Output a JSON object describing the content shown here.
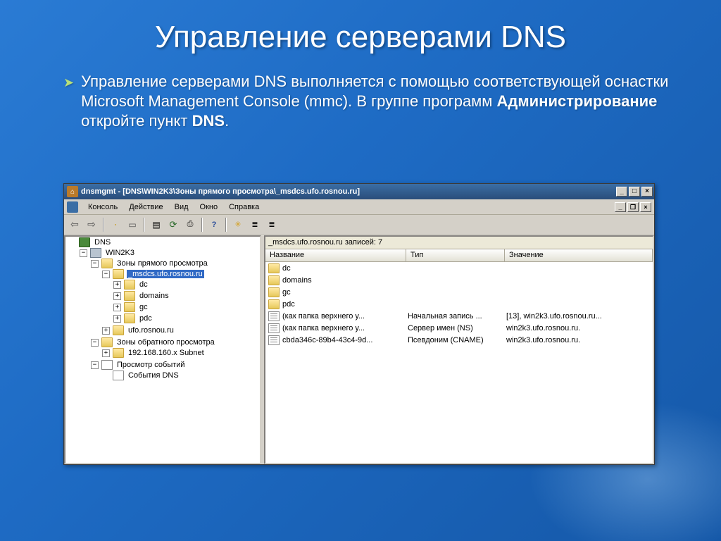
{
  "slide": {
    "title": "Управление серверами DNS",
    "bullet_pre": "Управление серверами DNS выполняется с помощью соответствующей оснастки Microsoft Management Console (mmc). В группе программ ",
    "bullet_bold1": "Администрирование",
    "bullet_mid": " откройте пункт ",
    "bullet_bold2": "DNS",
    "bullet_post": "."
  },
  "window": {
    "title": "dnsmgmt - [DNS\\WIN2K3\\Зоны прямого просмотра\\_msdcs.ufo.rosnou.ru]",
    "menus": [
      "Консоль",
      "Действие",
      "Вид",
      "Окно",
      "Справка"
    ]
  },
  "tree": {
    "root": "DNS",
    "server": "WIN2K3",
    "fwd": "Зоны прямого просмотра",
    "sel": "_msdcs.ufo.rosnou.ru",
    "sub": [
      "dc",
      "domains",
      "gc",
      "pdc"
    ],
    "sibling": "ufo.rosnou.ru",
    "rev": "Зоны обратного просмотра",
    "revitem": "192.168.160.x Subnet",
    "events": "Просмотр событий",
    "evtitem": "События DNS"
  },
  "list": {
    "path": "_msdcs.ufo.rosnou.ru   записей: 7",
    "cols": [
      "Название",
      "Тип",
      "Значение"
    ],
    "folders": [
      "dc",
      "domains",
      "gc",
      "pdc"
    ],
    "records": [
      {
        "name": "(как папка верхнего у...",
        "type": "Начальная запись ...",
        "val": "[13], win2k3.ufo.rosnou.ru..."
      },
      {
        "name": "(как папка верхнего у...",
        "type": "Сервер имен (NS)",
        "val": "win2k3.ufo.rosnou.ru."
      },
      {
        "name": "cbda346c-89b4-43c4-9d...",
        "type": "Псевдоним (CNAME)",
        "val": "win2k3.ufo.rosnou.ru."
      }
    ]
  }
}
